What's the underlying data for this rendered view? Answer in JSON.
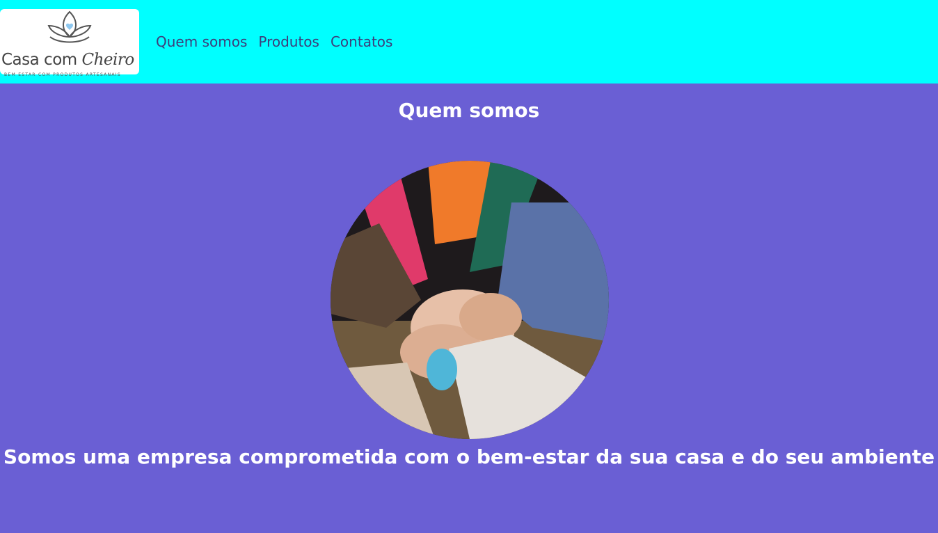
{
  "brand": {
    "name_part1": "Casa com ",
    "name_part2": "Cheiro",
    "tagline": "BEM ESTAR COM PRODUTOS ARTESANAIS"
  },
  "nav": {
    "items": [
      {
        "label": "Quem somos"
      },
      {
        "label": "Produtos"
      },
      {
        "label": "Contatos"
      }
    ]
  },
  "main": {
    "title": "Quem somos",
    "tagline": "Somos uma empresa comprometida com o bem-estar da sua casa e do seu ambiente"
  },
  "colors": {
    "header_bg": "#00ffff",
    "page_bg": "#6a5fd4",
    "nav_text": "#3d3d7a",
    "heading_text": "#ffffff"
  }
}
